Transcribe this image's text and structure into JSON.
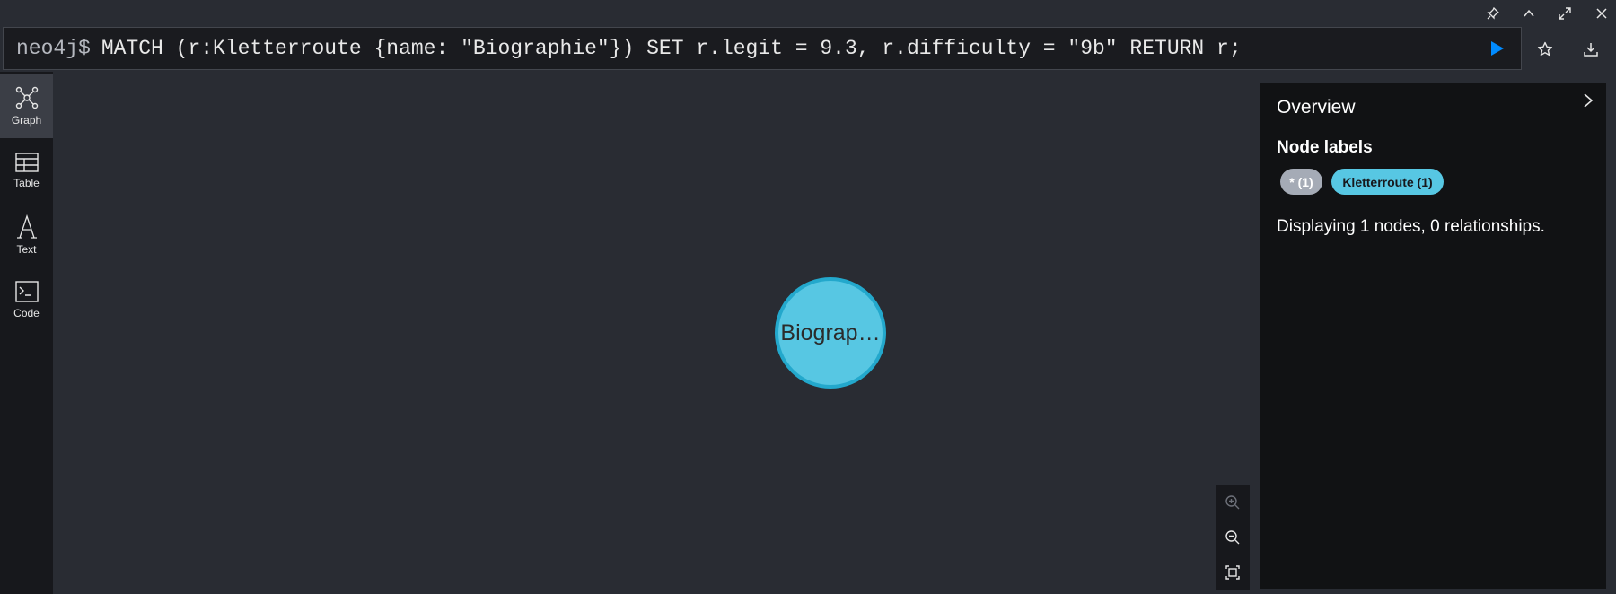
{
  "window": {
    "icons": [
      "pin-icon",
      "chevron-up-icon",
      "maximize-icon",
      "close-icon"
    ]
  },
  "editor": {
    "prompt": "neo4j$",
    "query": "MATCH (r:Kletterroute {name: \"Biographie\"}) SET r.legit = 9.3, r.difficulty = \"9b\" RETURN r;",
    "run_icon": "play-icon",
    "favorite_icon": "star-icon",
    "download_icon": "download-icon",
    "colors": {
      "run": "#018bff"
    }
  },
  "sidebar": {
    "items": [
      {
        "label": "Graph",
        "icon": "graph-icon",
        "active": true
      },
      {
        "label": "Table",
        "icon": "table-icon",
        "active": false
      },
      {
        "label": "Text",
        "icon": "text-icon",
        "active": false
      },
      {
        "label": "Code",
        "icon": "code-icon",
        "active": false
      }
    ]
  },
  "graph": {
    "node": {
      "caption": "Biograp…",
      "color": "#57c7e3",
      "border": "#23a8cc"
    },
    "zoom": {
      "icons": [
        "zoom-in-icon",
        "zoom-out-icon",
        "fit-icon"
      ]
    }
  },
  "overview": {
    "title": "Overview",
    "node_labels_heading": "Node labels",
    "pills": [
      {
        "text": "* (1)",
        "color": "#a5abb6"
      },
      {
        "text": "Kletterroute (1)",
        "color": "#57c7e3"
      }
    ],
    "summary": "Displaying 1 nodes, 0 relationships."
  }
}
